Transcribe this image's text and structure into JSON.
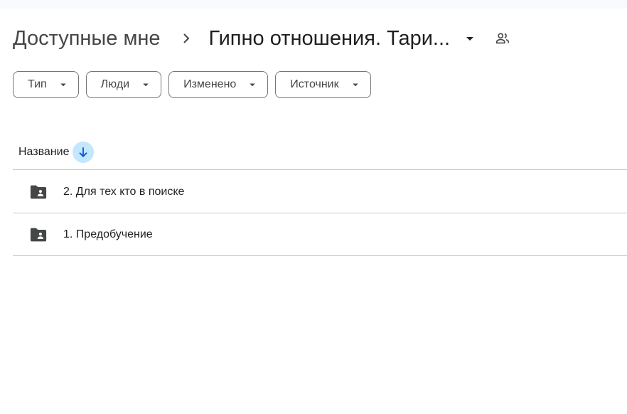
{
  "breadcrumb": {
    "root": "Доступные мне",
    "current": "Гипно отношения. Тари..."
  },
  "filters": [
    {
      "label": "Тип"
    },
    {
      "label": "Люди"
    },
    {
      "label": "Изменено"
    },
    {
      "label": "Источник"
    }
  ],
  "list": {
    "column_name": "Название",
    "sort_direction": "descending",
    "rows": [
      {
        "name": "2. Для тех кто в поиске",
        "icon": "shared-folder-icon"
      },
      {
        "name": "1. Предобучение",
        "icon": "shared-folder-icon"
      }
    ]
  },
  "colors": {
    "accent": "#c2e7ff",
    "accent_icon": "#0b57d0",
    "icon": "#444746",
    "divider": "#c7c7c7"
  }
}
